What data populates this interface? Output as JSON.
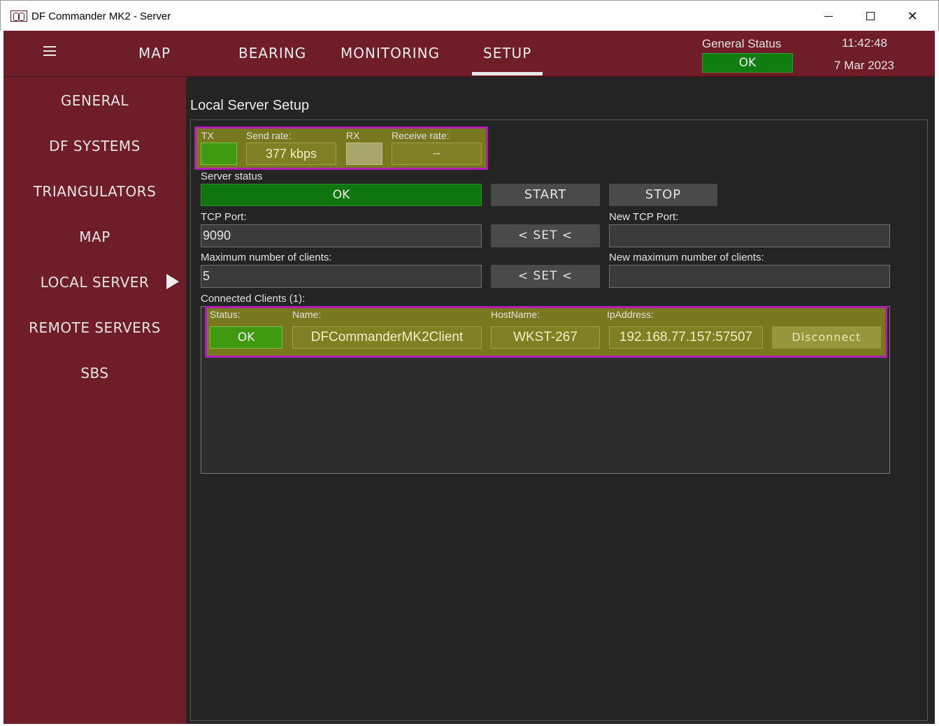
{
  "window": {
    "title": "DF Commander MK2 - Server",
    "controls": {
      "minimize": "minimize-icon",
      "maximize": "maximize-icon",
      "close": "close-icon",
      "close_glyph": "✕"
    }
  },
  "topnav": {
    "tabs": [
      "MAP",
      "BEARING",
      "MONITORING",
      "SETUP"
    ],
    "active_tab": "SETUP",
    "general_status_label": "General Status",
    "general_status_value": "OK",
    "time": "11:42:48",
    "date": "7 Mar 2023"
  },
  "sidebar": {
    "items": [
      "GENERAL",
      "DF SYSTEMS",
      "TRIANGULATORS",
      "MAP",
      "LOCAL SERVER",
      "REMOTE SERVERS",
      "SBS"
    ],
    "active_item": "LOCAL SERVER"
  },
  "panel": {
    "title": "Local Server Setup",
    "traffic": {
      "tx_label": "TX",
      "send_rate_label": "Send rate:",
      "send_rate_value": "377 kbps",
      "rx_label": "RX",
      "receive_rate_label": "Receive rate:",
      "receive_rate_value": "--"
    },
    "server_status_label": "Server status",
    "server_status_value": "OK",
    "start_label": "START",
    "stop_label": "STOP",
    "tcp_port_label": "TCP Port:",
    "tcp_port_value": "9090",
    "set_label": "< SET <",
    "new_tcp_port_label": "New TCP Port:",
    "new_tcp_port_value": "",
    "max_clients_label": "Maximum number of clients:",
    "max_clients_value": "5",
    "new_max_clients_label": "New maximum number of clients:",
    "new_max_clients_value": "",
    "connected_clients_label": "Connected Clients (1):",
    "client_headers": {
      "status": "Status:",
      "name": "Name:",
      "hostname": "HostName:",
      "ip": "IpAddress:"
    },
    "clients": [
      {
        "status": "OK",
        "name": "DFCommanderMK2Client",
        "hostname": "WKST-267",
        "ip": "192.168.77.157:57507",
        "action": "Disconnect"
      }
    ]
  },
  "colors": {
    "brand": "#6f1d28",
    "background": "#242424",
    "ok_green": "#0f750f",
    "highlight_border": "#b21db5",
    "olive": "#7f7f24"
  }
}
